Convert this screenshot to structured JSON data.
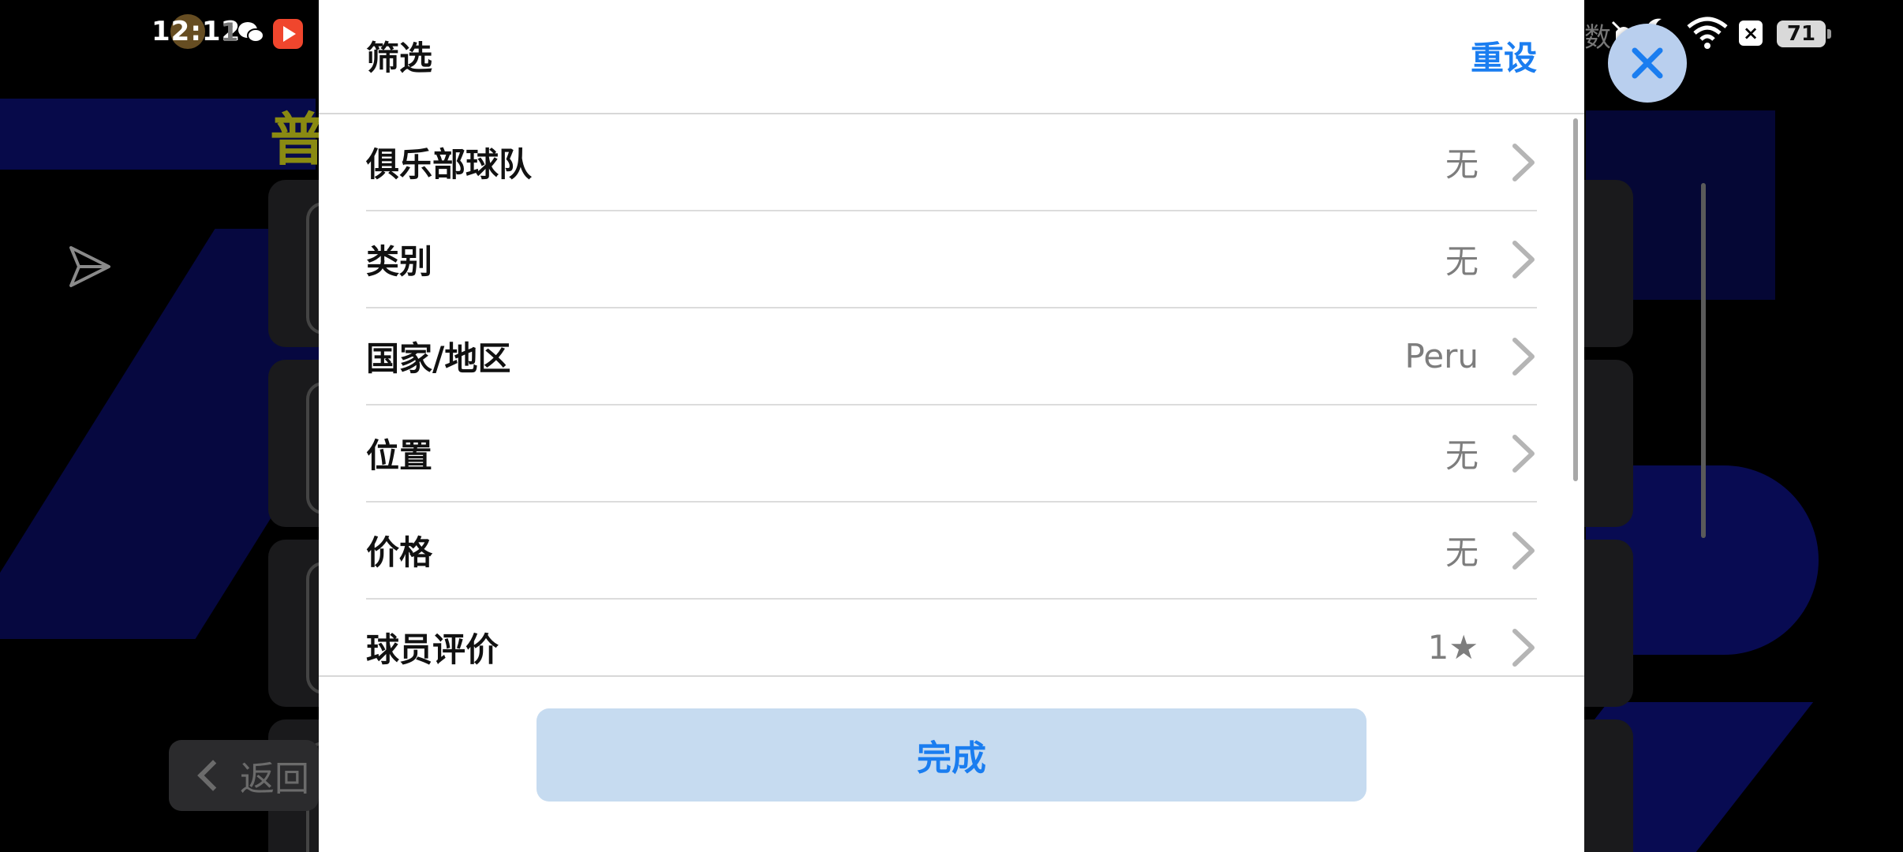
{
  "status_bar": {
    "time": "12:12",
    "notification_count": "1",
    "right_text": "数",
    "battery": "71"
  },
  "background_app": {
    "title_partial": "普",
    "back_label": "返回"
  },
  "filter_sheet": {
    "title": "筛选",
    "reset_label": "重设",
    "rows": [
      {
        "label": "俱乐部球队",
        "value": "无"
      },
      {
        "label": "类别",
        "value": "无"
      },
      {
        "label": "国家/地区",
        "value": "Peru"
      },
      {
        "label": "位置",
        "value": "无"
      },
      {
        "label": "价格",
        "value": "无"
      },
      {
        "label": "球员评价",
        "value": "1★"
      }
    ],
    "done_label": "完成"
  },
  "colors": {
    "accent": "#1a7df0",
    "done_button_bg": "#c6dbf0",
    "value_gray": "#7d7d7d"
  },
  "icons": {
    "float_close": "close-icon",
    "row_arrow": "chevron-right-icon",
    "send": "send-icon"
  }
}
